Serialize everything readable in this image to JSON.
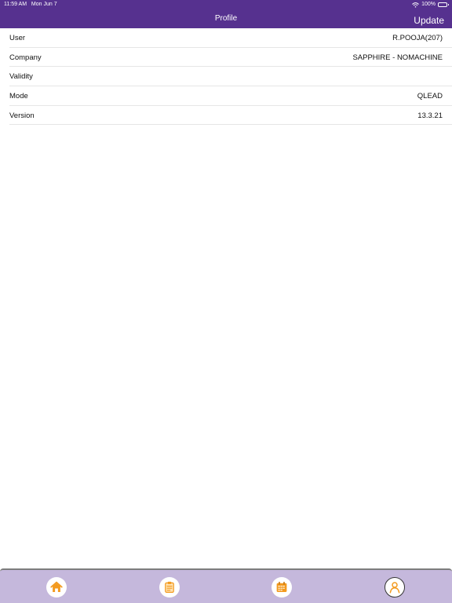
{
  "status_bar": {
    "time": "11:59 AM",
    "date": "Mon Jun 7",
    "battery": "100%",
    "icons": [
      "wifi-icon",
      "battery-icon"
    ]
  },
  "header": {
    "title": "Profile",
    "update_label": "Update"
  },
  "profile": {
    "rows": [
      {
        "label": "User",
        "value": "R.POOJA(207)"
      },
      {
        "label": "Company",
        "value": "SAPPHIRE - NOMACHINE"
      },
      {
        "label": "Validity",
        "value": ""
      },
      {
        "label": "Mode",
        "value": "QLEAD"
      },
      {
        "label": "Version",
        "value": "13.3.21"
      }
    ]
  },
  "tab_bar": {
    "tabs": [
      {
        "icon": "home-icon"
      },
      {
        "icon": "clipboard-icon"
      },
      {
        "icon": "calendar-icon"
      },
      {
        "icon": "profile-icon",
        "selected": true
      }
    ]
  },
  "colors": {
    "header_bg": "#56318f",
    "tab_bar_bg": "#c5b8dc",
    "icon_orange": "#f39a1f"
  }
}
